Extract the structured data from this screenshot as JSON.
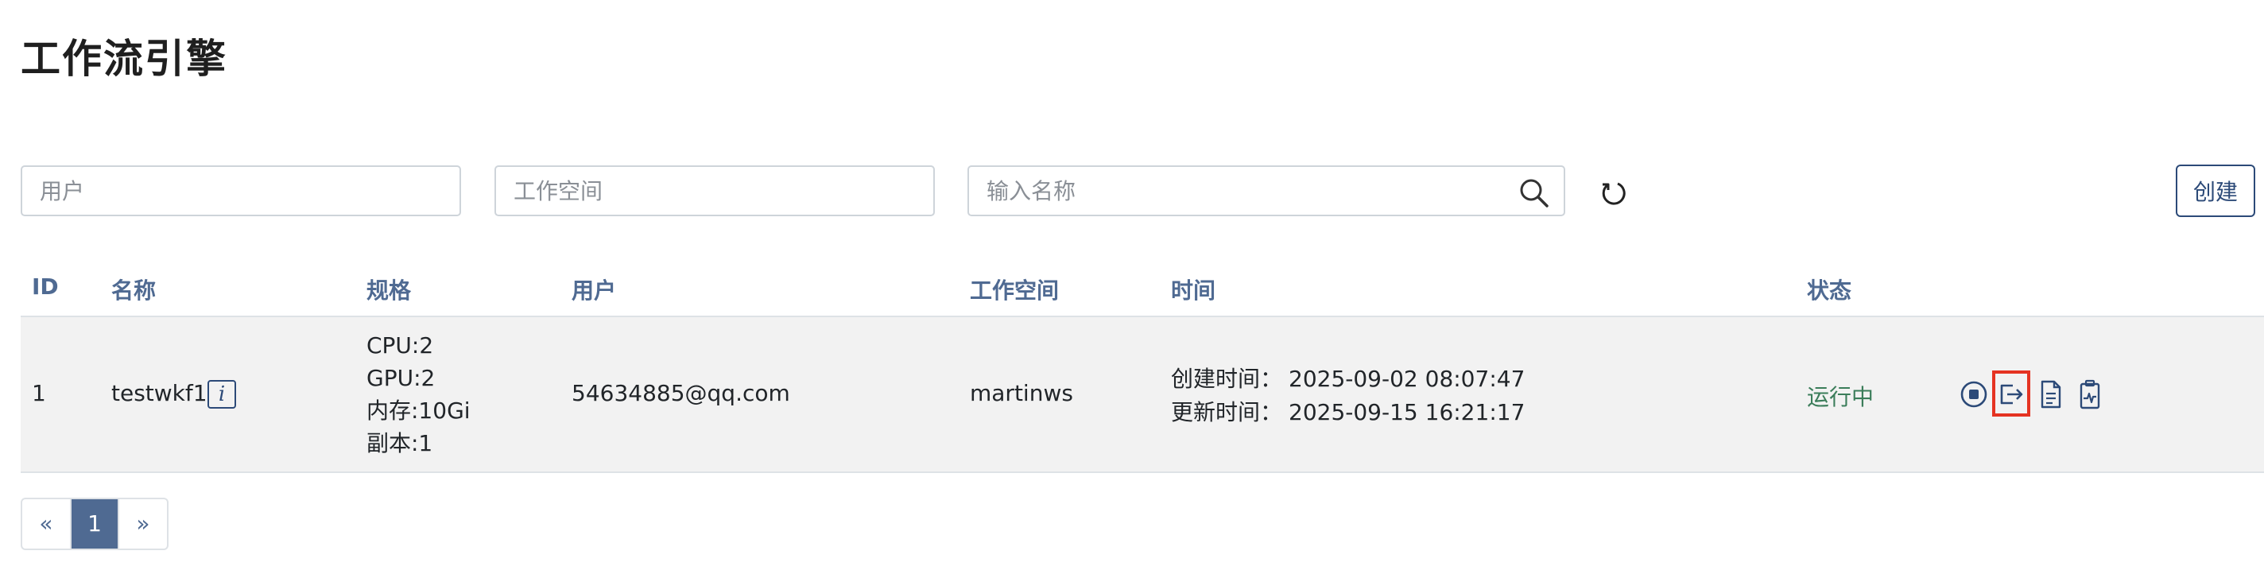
{
  "page": {
    "title": "工作流引擎"
  },
  "filters": {
    "user_placeholder": "用户",
    "workspace_placeholder": "工作空间",
    "name_placeholder": "输入名称",
    "search_icon": "search-icon",
    "refresh_icon": "refresh-icon"
  },
  "toolbar": {
    "create_label": "创建"
  },
  "table": {
    "headers": [
      "ID",
      "名称",
      "规格",
      "用户",
      "工作空间",
      "时间",
      "状态"
    ],
    "rows": [
      {
        "id": "1",
        "name": "testwkf1",
        "info_icon_text": "i",
        "spec": [
          "CPU:2",
          "GPU:2",
          "内存:10Gi",
          "副本:1"
        ],
        "user": "54634885@qq.com",
        "workspace": "martinws",
        "created_label": "创建时间：",
        "created": "2025-09-02 08:07:47",
        "updated_label": "更新时间：",
        "updated": "2025-09-15 16:21:17",
        "status": "运行中",
        "actions": [
          "stop-icon",
          "logout-icon",
          "document-icon",
          "monitor-icon"
        ]
      }
    ]
  },
  "pagination": {
    "prev": "«",
    "current": "1",
    "next": "»"
  },
  "colors": {
    "accent": "#2c4a78",
    "header_text": "#4f6a92",
    "status_running": "#3b7d5a",
    "highlight": "#e53322"
  }
}
